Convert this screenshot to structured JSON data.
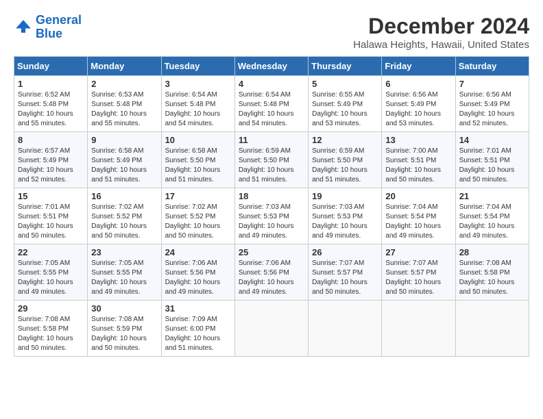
{
  "header": {
    "logo_line1": "General",
    "logo_line2": "Blue",
    "month": "December 2024",
    "location": "Halawa Heights, Hawaii, United States"
  },
  "weekdays": [
    "Sunday",
    "Monday",
    "Tuesday",
    "Wednesday",
    "Thursday",
    "Friday",
    "Saturday"
  ],
  "weeks": [
    [
      {
        "day": "1",
        "sunrise": "6:52 AM",
        "sunset": "5:48 PM",
        "daylight": "10 hours and 55 minutes."
      },
      {
        "day": "2",
        "sunrise": "6:53 AM",
        "sunset": "5:48 PM",
        "daylight": "10 hours and 55 minutes."
      },
      {
        "day": "3",
        "sunrise": "6:54 AM",
        "sunset": "5:48 PM",
        "daylight": "10 hours and 54 minutes."
      },
      {
        "day": "4",
        "sunrise": "6:54 AM",
        "sunset": "5:48 PM",
        "daylight": "10 hours and 54 minutes."
      },
      {
        "day": "5",
        "sunrise": "6:55 AM",
        "sunset": "5:49 PM",
        "daylight": "10 hours and 53 minutes."
      },
      {
        "day": "6",
        "sunrise": "6:56 AM",
        "sunset": "5:49 PM",
        "daylight": "10 hours and 53 minutes."
      },
      {
        "day": "7",
        "sunrise": "6:56 AM",
        "sunset": "5:49 PM",
        "daylight": "10 hours and 52 minutes."
      }
    ],
    [
      {
        "day": "8",
        "sunrise": "6:57 AM",
        "sunset": "5:49 PM",
        "daylight": "10 hours and 52 minutes."
      },
      {
        "day": "9",
        "sunrise": "6:58 AM",
        "sunset": "5:49 PM",
        "daylight": "10 hours and 51 minutes."
      },
      {
        "day": "10",
        "sunrise": "6:58 AM",
        "sunset": "5:50 PM",
        "daylight": "10 hours and 51 minutes."
      },
      {
        "day": "11",
        "sunrise": "6:59 AM",
        "sunset": "5:50 PM",
        "daylight": "10 hours and 51 minutes."
      },
      {
        "day": "12",
        "sunrise": "6:59 AM",
        "sunset": "5:50 PM",
        "daylight": "10 hours and 51 minutes."
      },
      {
        "day": "13",
        "sunrise": "7:00 AM",
        "sunset": "5:51 PM",
        "daylight": "10 hours and 50 minutes."
      },
      {
        "day": "14",
        "sunrise": "7:01 AM",
        "sunset": "5:51 PM",
        "daylight": "10 hours and 50 minutes."
      }
    ],
    [
      {
        "day": "15",
        "sunrise": "7:01 AM",
        "sunset": "5:51 PM",
        "daylight": "10 hours and 50 minutes."
      },
      {
        "day": "16",
        "sunrise": "7:02 AM",
        "sunset": "5:52 PM",
        "daylight": "10 hours and 50 minutes."
      },
      {
        "day": "17",
        "sunrise": "7:02 AM",
        "sunset": "5:52 PM",
        "daylight": "10 hours and 50 minutes."
      },
      {
        "day": "18",
        "sunrise": "7:03 AM",
        "sunset": "5:53 PM",
        "daylight": "10 hours and 49 minutes."
      },
      {
        "day": "19",
        "sunrise": "7:03 AM",
        "sunset": "5:53 PM",
        "daylight": "10 hours and 49 minutes."
      },
      {
        "day": "20",
        "sunrise": "7:04 AM",
        "sunset": "5:54 PM",
        "daylight": "10 hours and 49 minutes."
      },
      {
        "day": "21",
        "sunrise": "7:04 AM",
        "sunset": "5:54 PM",
        "daylight": "10 hours and 49 minutes."
      }
    ],
    [
      {
        "day": "22",
        "sunrise": "7:05 AM",
        "sunset": "5:55 PM",
        "daylight": "10 hours and 49 minutes."
      },
      {
        "day": "23",
        "sunrise": "7:05 AM",
        "sunset": "5:55 PM",
        "daylight": "10 hours and 49 minutes."
      },
      {
        "day": "24",
        "sunrise": "7:06 AM",
        "sunset": "5:56 PM",
        "daylight": "10 hours and 49 minutes."
      },
      {
        "day": "25",
        "sunrise": "7:06 AM",
        "sunset": "5:56 PM",
        "daylight": "10 hours and 49 minutes."
      },
      {
        "day": "26",
        "sunrise": "7:07 AM",
        "sunset": "5:57 PM",
        "daylight": "10 hours and 50 minutes."
      },
      {
        "day": "27",
        "sunrise": "7:07 AM",
        "sunset": "5:57 PM",
        "daylight": "10 hours and 50 minutes."
      },
      {
        "day": "28",
        "sunrise": "7:08 AM",
        "sunset": "5:58 PM",
        "daylight": "10 hours and 50 minutes."
      }
    ],
    [
      {
        "day": "29",
        "sunrise": "7:08 AM",
        "sunset": "5:58 PM",
        "daylight": "10 hours and 50 minutes."
      },
      {
        "day": "30",
        "sunrise": "7:08 AM",
        "sunset": "5:59 PM",
        "daylight": "10 hours and 50 minutes."
      },
      {
        "day": "31",
        "sunrise": "7:09 AM",
        "sunset": "6:00 PM",
        "daylight": "10 hours and 51 minutes."
      },
      null,
      null,
      null,
      null
    ]
  ]
}
